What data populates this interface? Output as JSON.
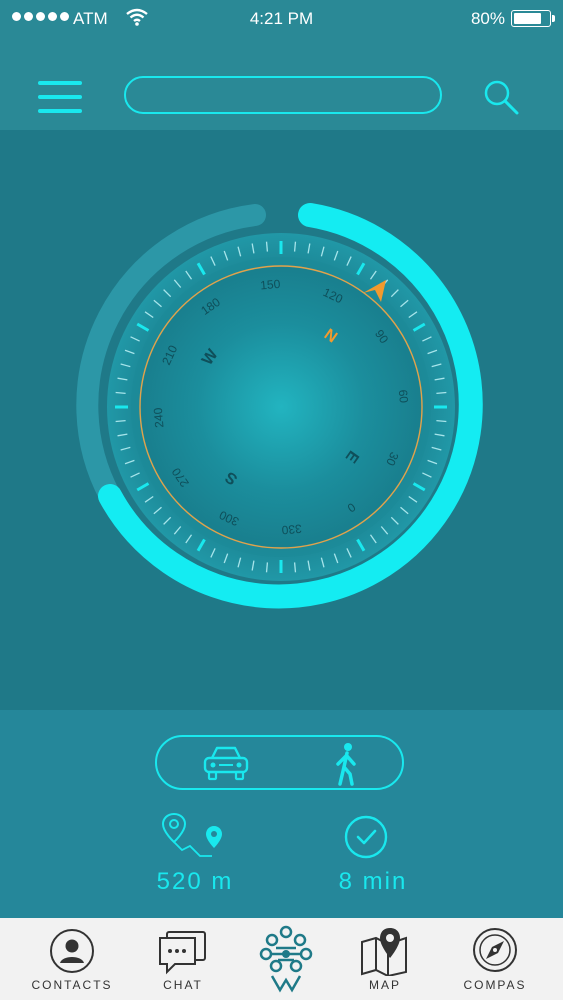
{
  "status_bar": {
    "carrier": "ATM",
    "time": "4:21 PM",
    "battery": "80%"
  },
  "search": {
    "placeholder": ""
  },
  "compass": {
    "degree_labels": [
      "0",
      "30",
      "60",
      "90",
      "120",
      "150",
      "180",
      "210",
      "240",
      "270",
      "300",
      "330"
    ],
    "cardinals": [
      "N",
      "E",
      "S",
      "W"
    ],
    "accent_color": "#19e8ee",
    "marker_color": "#f29a2e"
  },
  "route": {
    "modes": [
      "car",
      "walk"
    ],
    "distance": "520 m",
    "duration": "8 min"
  },
  "tabs": [
    {
      "label": "CONTACTS",
      "icon": "contacts-icon"
    },
    {
      "label": "CHAT",
      "icon": "chat-icon"
    },
    {
      "label": "",
      "icon": "app-logo"
    },
    {
      "label": "MAP",
      "icon": "map-icon"
    },
    {
      "label": "COMPAS",
      "icon": "compass-icon"
    }
  ]
}
